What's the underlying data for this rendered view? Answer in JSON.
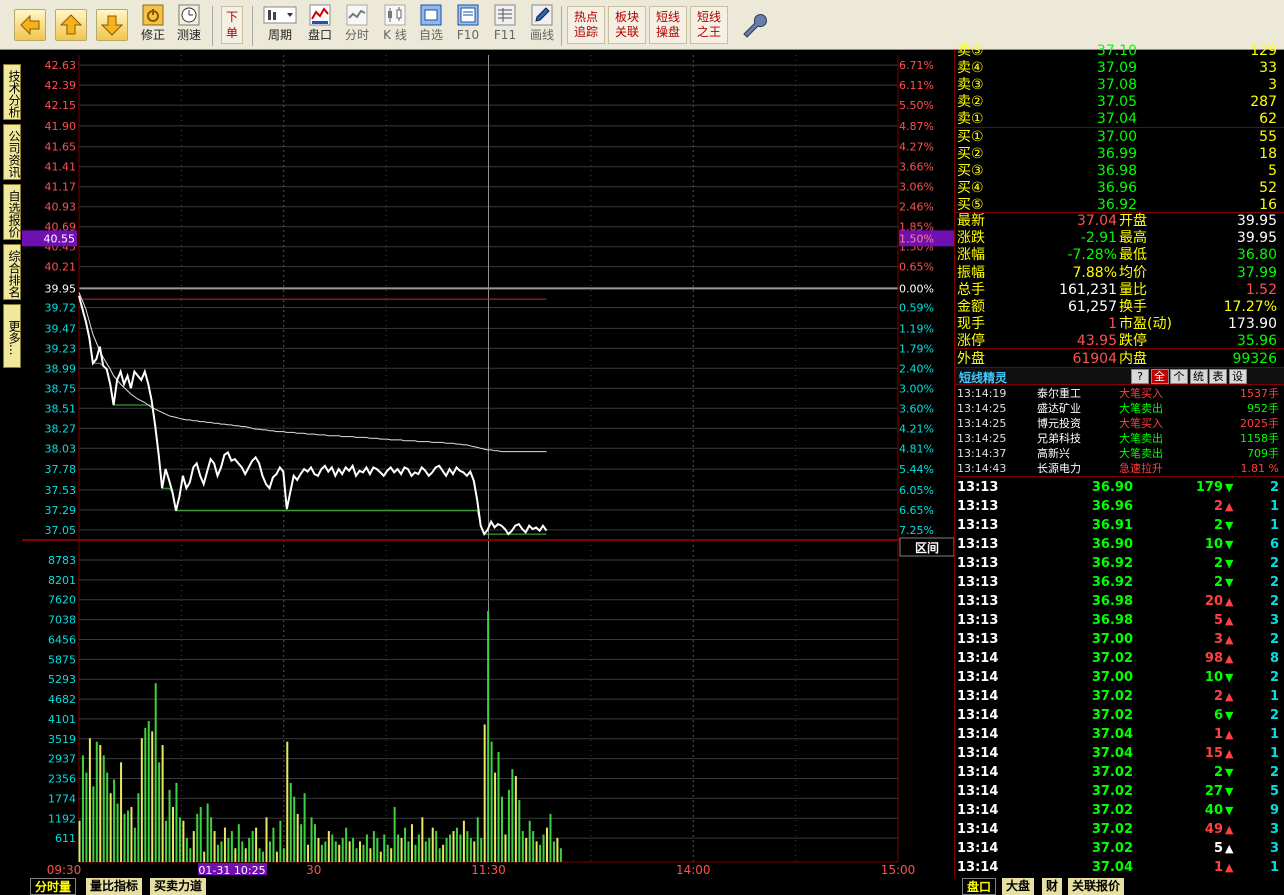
{
  "toolbar": {
    "back": "back-arrow",
    "up": "up-arrow",
    "down": "down-arrow",
    "fix": "修正",
    "speed": "测速",
    "order_top": "下",
    "order_bot": "单",
    "period": "周期",
    "handicap": "盘口",
    "timeshare": "分时",
    "kline": "K 线",
    "watch": "自选",
    "f10": "F10",
    "f11": "F11",
    "draw": "画线",
    "hot1": "热点",
    "hot2": "追踪",
    "sec1": "板块",
    "sec2": "关联",
    "st1": "短线",
    "st2": "操盘",
    "king1": "短线",
    "king2": "之王"
  },
  "left_tabs": [
    "技术分析",
    "公司资讯",
    "自选报价",
    "综合排名",
    "更多..."
  ],
  "chart_data": {
    "type": "line",
    "prev_close": 39.95,
    "price_axis": [
      42.63,
      42.39,
      42.15,
      41.9,
      41.65,
      41.41,
      41.17,
      40.93,
      40.69,
      40.45,
      40.21,
      39.95,
      39.72,
      39.47,
      39.23,
      38.99,
      38.75,
      38.51,
      38.27,
      38.03,
      37.78,
      37.53,
      37.29,
      37.05
    ],
    "price_axis_labels": [
      "42.63",
      "42.39",
      "42.15",
      "41.90",
      "41.65",
      "41.41",
      "41.17",
      "40.93",
      "40.69",
      "40.45",
      "40.21",
      "39.95",
      "39.72",
      "39.47",
      "39.23",
      "38.99",
      "38.75",
      "38.51",
      "38.27",
      "38.03",
      "37.78",
      "37.53",
      "37.29",
      "37.05"
    ],
    "pct_axis_labels": [
      "6.71%",
      "6.11%",
      "5.50%",
      "4.87%",
      "4.27%",
      "3.66%",
      "3.06%",
      "2.46%",
      "1.85%",
      "1.50%",
      "0.65%",
      "0.00%",
      "0.59%",
      "1.19%",
      "1.79%",
      "2.40%",
      "3.00%",
      "3.60%",
      "4.21%",
      "4.81%",
      "5.44%",
      "6.05%",
      "6.65%",
      "7.25%"
    ],
    "cursor_price": "40.55",
    "cursor_pct": "1.50%",
    "volume_axis": [
      "8783",
      "8201",
      "7620",
      "7038",
      "6456",
      "5875",
      "5293",
      "4682",
      "4101",
      "3519",
      "2937",
      "2356",
      "1774",
      "1192",
      "611"
    ],
    "vol_max": 9000,
    "time_labels": [
      "09:30",
      "30",
      "11:30",
      "14:00",
      "15:00"
    ],
    "cursor_time": "01-31 10:25",
    "range_label": "区间",
    "price_series": [
      39.86,
      39.7,
      39.55,
      39.35,
      39.05,
      39.1,
      39.25,
      39.02,
      38.98,
      38.8,
      38.55,
      38.85,
      38.95,
      38.8,
      38.9,
      38.75,
      38.95,
      38.9,
      38.85,
      38.95,
      38.8,
      38.6,
      38.3,
      37.95,
      37.55,
      37.78,
      37.65,
      37.5,
      37.28,
      37.45,
      37.7,
      37.55,
      37.62,
      37.8,
      37.85,
      37.7,
      37.6,
      37.75,
      37.9,
      37.85,
      37.7,
      37.8,
      37.95,
      37.98,
      37.88,
      37.9,
      37.85,
      37.8,
      37.72,
      37.8,
      37.88,
      37.92,
      37.85,
      37.7,
      37.6,
      37.55,
      37.68,
      37.72,
      37.8,
      37.75,
      37.3,
      37.5,
      37.7,
      37.65,
      37.72,
      37.78,
      37.75,
      37.8,
      37.72,
      37.7,
      37.78,
      37.82,
      37.75,
      37.8,
      37.7,
      37.78,
      37.72,
      37.8,
      37.76,
      37.82,
      37.7,
      37.76,
      37.74,
      37.8,
      37.72,
      37.8,
      37.78,
      37.74,
      37.7,
      37.76,
      37.8,
      37.74,
      37.78,
      37.72,
      37.8,
      37.78,
      37.7,
      37.74,
      37.72,
      37.8,
      37.76,
      37.7,
      37.74,
      37.8,
      37.82,
      37.76,
      37.7,
      37.78,
      37.72,
      37.8,
      37.76,
      37.74,
      37.7,
      37.75,
      37.64,
      37.4,
      37.1,
      37.0,
      37.05,
      37.15,
      37.08,
      37.12,
      37.1,
      37.06,
      37.0,
      37.04,
      37.1,
      37.12,
      37.06,
      37.02,
      37.1,
      37.06,
      37.08,
      37.04,
      37.1,
      37.04
    ],
    "avg_series": [
      39.9,
      39.8,
      39.7,
      39.55,
      39.4,
      39.3,
      39.2,
      39.12,
      39.05,
      38.98,
      38.9,
      38.85,
      38.8,
      38.76,
      38.72,
      38.68,
      38.65,
      38.62,
      38.6,
      38.58,
      38.55,
      38.52,
      38.5,
      38.48,
      38.46,
      38.44,
      38.42,
      38.41,
      38.4,
      38.39,
      38.38,
      38.37,
      38.37,
      38.36,
      38.36,
      38.35,
      38.35,
      38.34,
      38.34,
      38.33,
      38.33,
      38.32,
      38.32,
      38.31,
      38.31,
      38.3,
      38.3,
      38.29,
      38.29,
      38.28,
      38.27,
      38.26,
      38.26,
      38.25,
      38.25,
      38.24,
      38.24,
      38.23,
      38.23,
      38.23,
      38.22,
      38.22,
      38.22,
      38.21,
      38.21,
      38.21,
      38.2,
      38.2,
      38.2,
      38.19,
      38.19,
      38.19,
      38.18,
      38.18,
      38.18,
      38.18,
      38.17,
      38.17,
      38.17,
      38.17,
      38.16,
      38.16,
      38.16,
      38.16,
      38.15,
      38.15,
      38.15,
      38.14,
      38.14,
      38.14,
      38.13,
      38.13,
      38.13,
      38.13,
      38.12,
      38.12,
      38.12,
      38.12,
      38.11,
      38.11,
      38.11,
      38.11,
      38.1,
      38.1,
      38.1,
      38.1,
      38.09,
      38.09,
      38.09,
      38.08,
      38.08,
      38.07,
      38.07,
      38.06,
      38.05,
      38.04,
      38.03,
      38.02,
      38.01,
      38.01,
      38.0,
      38.0,
      37.99,
      37.99,
      37.99,
      37.99,
      37.99,
      37.99,
      37.99,
      37.99,
      37.99,
      37.99,
      37.99,
      37.99,
      37.99,
      37.99
    ],
    "volume_series": [
      1200,
      3100,
      2600,
      3600,
      2200,
      3500,
      3400,
      3100,
      2600,
      2000,
      2400,
      1700,
      2900,
      1400,
      1500,
      1600,
      1000,
      2000,
      3600,
      3900,
      4100,
      3800,
      5200,
      2900,
      3400,
      1200,
      2100,
      1600,
      2300,
      1300,
      1200,
      700,
      400,
      900,
      1400,
      1600,
      300,
      1700,
      1300,
      900,
      500,
      600,
      1000,
      700,
      900,
      400,
      1100,
      600,
      400,
      700,
      900,
      1000,
      400,
      300,
      1300,
      600,
      1000,
      300,
      1200,
      400,
      3500,
      2300,
      1900,
      1400,
      1100,
      2000,
      500,
      1300,
      1100,
      700,
      500,
      600,
      900,
      800,
      600,
      500,
      700,
      1000,
      600,
      700,
      400,
      600,
      500,
      800,
      400,
      900,
      700,
      300,
      800,
      500,
      400,
      1600,
      800,
      700,
      1000,
      600,
      1100,
      500,
      800,
      1300,
      600,
      700,
      1000,
      900,
      400,
      500,
      700,
      800,
      900,
      1000,
      800,
      1200,
      900,
      700,
      600,
      1300,
      700,
      4000,
      7300,
      3500,
      2600,
      3200,
      1900,
      800,
      2100,
      2700,
      2500,
      1800,
      900,
      700,
      1200,
      900,
      600,
      500,
      800,
      1000,
      1400,
      600,
      700,
      400
    ],
    "low_line_price": 37.0
  },
  "order_book": {
    "asks": [
      {
        "label": "卖⑤",
        "price": "37.10",
        "vol": "129"
      },
      {
        "label": "卖④",
        "price": "37.09",
        "vol": "33"
      },
      {
        "label": "卖③",
        "price": "37.08",
        "vol": "3"
      },
      {
        "label": "卖②",
        "price": "37.05",
        "vol": "287"
      },
      {
        "label": "卖①",
        "price": "37.04",
        "vol": "62"
      }
    ],
    "bids": [
      {
        "label": "买①",
        "price": "37.00",
        "vol": "55"
      },
      {
        "label": "买②",
        "price": "36.99",
        "vol": "18"
      },
      {
        "label": "买③",
        "price": "36.98",
        "vol": "5"
      },
      {
        "label": "买④",
        "price": "36.96",
        "vol": "52"
      },
      {
        "label": "买⑤",
        "price": "36.92",
        "vol": "16"
      }
    ]
  },
  "quote": [
    {
      "l1": "最新",
      "v1": "37.04",
      "c1": "#ff5050",
      "l2": "开盘",
      "v2": "39.95",
      "c2": "#ffffff"
    },
    {
      "l1": "涨跌",
      "v1": "-2.91",
      "c1": "#00ff00",
      "l2": "最高",
      "v2": "39.95",
      "c2": "#ffffff"
    },
    {
      "l1": "涨幅",
      "v1": "-7.28%",
      "c1": "#00ff00",
      "l2": "最低",
      "v2": "36.80",
      "c2": "#00ff00"
    },
    {
      "l1": "振幅",
      "v1": "7.88%",
      "c1": "#ffff00",
      "l2": "均价",
      "v2": "37.99",
      "c2": "#00ff00"
    },
    {
      "l1": "总手",
      "v1": "161,231",
      "c1": "#ffffff",
      "l2": "量比",
      "v2": "1.52",
      "c2": "#ff5050"
    },
    {
      "l1": "金额",
      "v1": "61,257",
      "c1": "#ffffff",
      "l2": "换手",
      "v2": "17.27%",
      "c2": "#ffff00"
    },
    {
      "l1": "现手",
      "v1": "1",
      "c1": "#ff5050",
      "l2": "市盈(动)",
      "v2": "173.90",
      "c2": "#ffffff"
    },
    {
      "l1": "涨停",
      "v1": "43.95",
      "c1": "#ff5050",
      "l2": "跌停",
      "v2": "35.96",
      "c2": "#00ff00"
    },
    {
      "l1": "外盘",
      "v1": "61904",
      "c1": "#ff5050",
      "l2": "内盘",
      "v2": "99326",
      "c2": "#00ff00"
    }
  ],
  "elf": {
    "title": "短线精灵",
    "buttons": [
      "?",
      "全",
      "个",
      "统",
      "表",
      "设"
    ],
    "rows": [
      {
        "t": "13:14:19",
        "name": "泰尔重工",
        "ev": "大笔买入",
        "val": "1537手",
        "c": "#ff4040"
      },
      {
        "t": "13:14:25",
        "name": "盛达矿业",
        "ev": "大笔卖出",
        "val": "952手",
        "c": "#00ff00"
      },
      {
        "t": "13:14:25",
        "name": "博元投资",
        "ev": "大笔买入",
        "val": "2025手",
        "c": "#ff4040"
      },
      {
        "t": "13:14:25",
        "name": "兄弟科技",
        "ev": "大笔卖出",
        "val": "1158手",
        "c": "#00ff00"
      },
      {
        "t": "13:14:37",
        "name": "高新兴",
        "ev": "大笔卖出",
        "val": "709手",
        "c": "#00ff00"
      },
      {
        "t": "13:14:43",
        "name": "长源电力",
        "ev": "急速拉升",
        "val": "1.81 %",
        "c": "#ff4040"
      }
    ]
  },
  "ticks": [
    {
      "t": "13:13",
      "p": "36.90",
      "v": "179",
      "d": "down",
      "n": "2"
    },
    {
      "t": "13:13",
      "p": "36.96",
      "v": "2",
      "d": "up",
      "n": "1"
    },
    {
      "t": "13:13",
      "p": "36.91",
      "v": "2",
      "d": "down",
      "n": "1"
    },
    {
      "t": "13:13",
      "p": "36.90",
      "v": "10",
      "d": "down",
      "n": "6"
    },
    {
      "t": "13:13",
      "p": "36.92",
      "v": "2",
      "d": "down",
      "n": "2"
    },
    {
      "t": "13:13",
      "p": "36.92",
      "v": "2",
      "d": "down",
      "n": "2"
    },
    {
      "t": "13:13",
      "p": "36.98",
      "v": "20",
      "d": "up",
      "n": "2"
    },
    {
      "t": "13:13",
      "p": "36.98",
      "v": "5",
      "d": "up",
      "n": "3"
    },
    {
      "t": "13:13",
      "p": "37.00",
      "v": "3",
      "d": "up",
      "n": "2"
    },
    {
      "t": "13:14",
      "p": "37.02",
      "v": "98",
      "d": "up",
      "n": "8"
    },
    {
      "t": "13:14",
      "p": "37.00",
      "v": "10",
      "d": "down",
      "n": "2"
    },
    {
      "t": "13:14",
      "p": "37.02",
      "v": "2",
      "d": "up",
      "n": "1"
    },
    {
      "t": "13:14",
      "p": "37.02",
      "v": "6",
      "d": "down",
      "n": "2"
    },
    {
      "t": "13:14",
      "p": "37.04",
      "v": "1",
      "d": "up",
      "n": "1"
    },
    {
      "t": "13:14",
      "p": "37.04",
      "v": "15",
      "d": "up",
      "n": "1"
    },
    {
      "t": "13:14",
      "p": "37.02",
      "v": "2",
      "d": "down",
      "n": "2"
    },
    {
      "t": "13:14",
      "p": "37.02",
      "v": "27",
      "d": "down",
      "n": "5"
    },
    {
      "t": "13:14",
      "p": "37.02",
      "v": "40",
      "d": "down",
      "n": "9"
    },
    {
      "t": "13:14",
      "p": "37.02",
      "v": "49",
      "d": "up",
      "n": "3"
    },
    {
      "t": "13:14",
      "p": "37.02",
      "v": "5",
      "d": "neutral",
      "n": "3"
    },
    {
      "t": "13:14",
      "p": "37.04",
      "v": "1",
      "d": "up",
      "n": "1"
    }
  ],
  "bottom_tabs_left": [
    "分时量",
    "量比指标",
    "买卖力道"
  ],
  "bottom_tabs_right": [
    "盘口",
    "大盘",
    "财",
    "关联报价"
  ],
  "colors": {
    "up": "#ff4040",
    "down": "#00ff00",
    "price_line": "#ffffff",
    "avg_line": "#e0e0e0",
    "grid": "#3a3a3a",
    "axis": "#7f0000"
  }
}
